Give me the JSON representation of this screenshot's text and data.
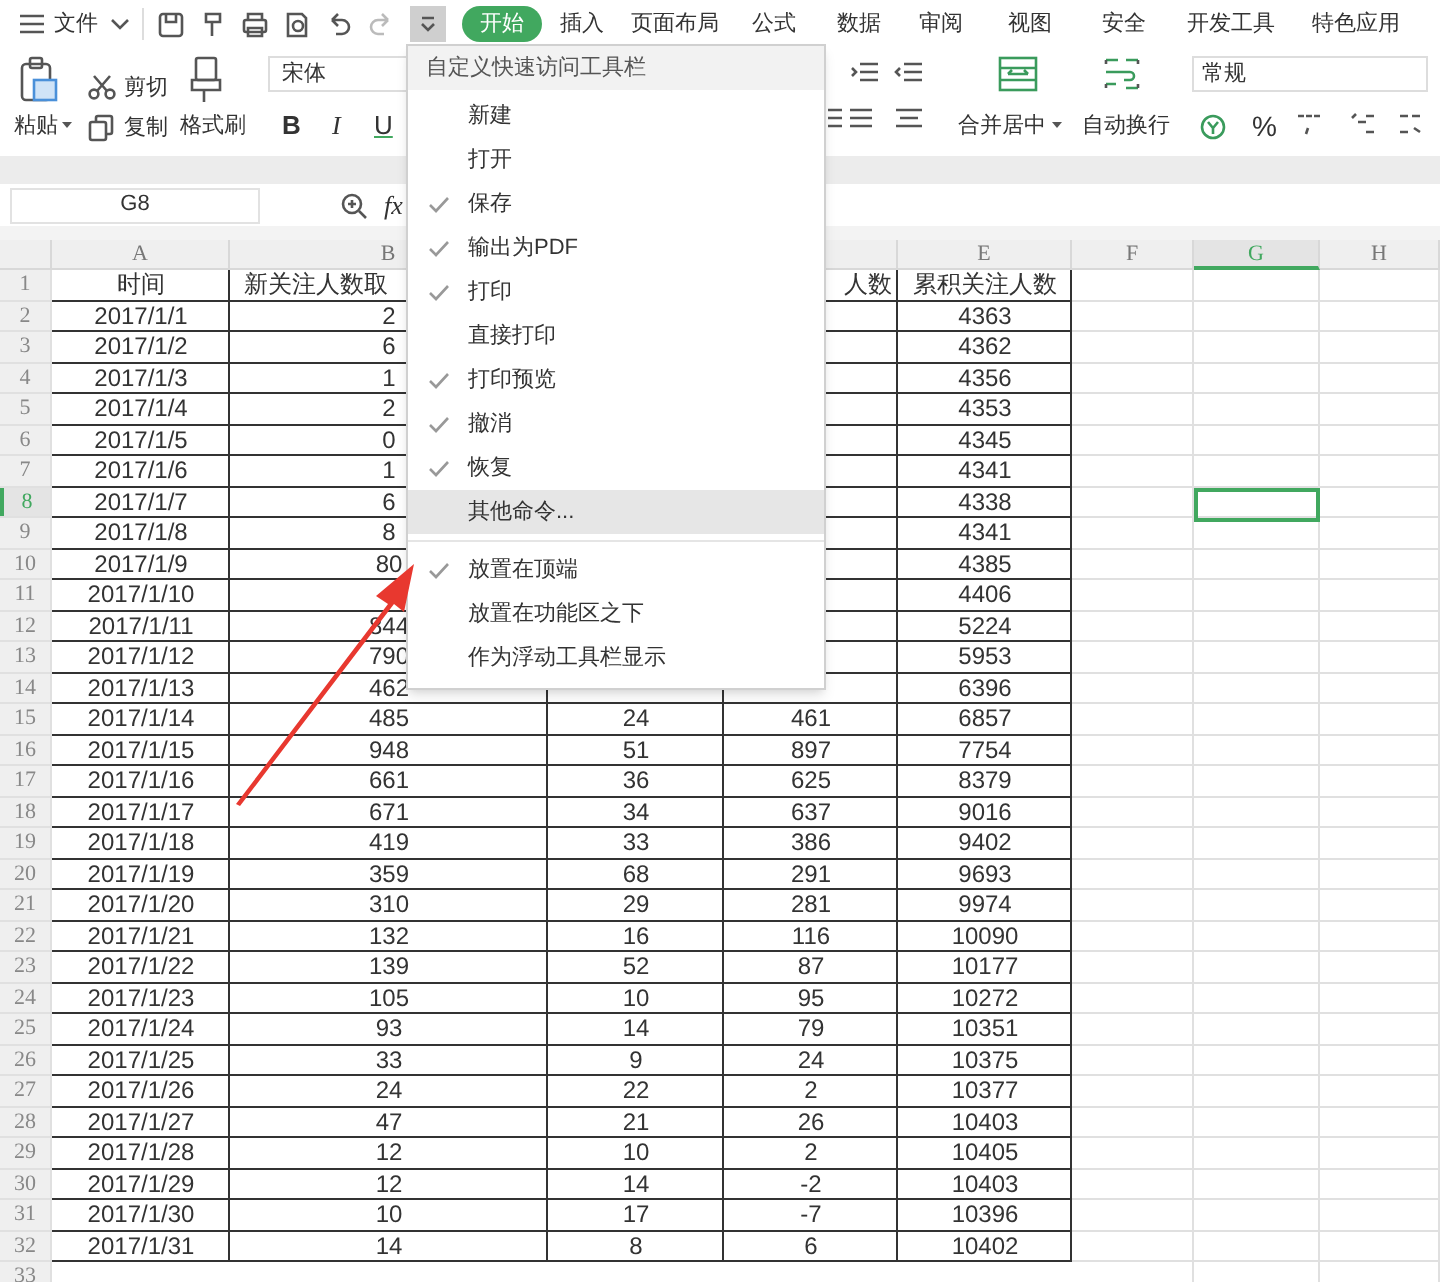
{
  "menubar": {
    "file": "文件",
    "quick_access_dropdown": {
      "expanded": true
    }
  },
  "tabs": [
    {
      "label": "开始",
      "selected": true
    },
    {
      "label": "插入",
      "selected": false
    },
    {
      "label": "页面布局",
      "selected": false
    },
    {
      "label": "公式",
      "selected": false
    },
    {
      "label": "数据",
      "selected": false
    },
    {
      "label": "审阅",
      "selected": false
    },
    {
      "label": "视图",
      "selected": false
    },
    {
      "label": "安全",
      "selected": false
    },
    {
      "label": "开发工具",
      "selected": false
    },
    {
      "label": "特色应用",
      "selected": false
    }
  ],
  "ribbon": {
    "paste": "粘贴",
    "cut": "剪切",
    "copy": "复制",
    "format_painter": "格式刷",
    "font": "宋体",
    "bold": "B",
    "italic": "I",
    "underline": "U",
    "merge": "合并居中",
    "wrap": "自动换行",
    "number_format": "常规",
    "percent": "%"
  },
  "formula_bar": {
    "name_box": "G8",
    "function_label": "fx"
  },
  "dropdown_menu": {
    "title": "自定义快速访问工具栏",
    "items": [
      {
        "kind": "command",
        "label": "新建",
        "checked": false,
        "selected": false
      },
      {
        "kind": "command",
        "label": "打开",
        "checked": false,
        "selected": false
      },
      {
        "kind": "command",
        "label": "保存",
        "checked": true,
        "selected": false
      },
      {
        "kind": "command",
        "label": "输出为PDF",
        "checked": true,
        "selected": false
      },
      {
        "kind": "command",
        "label": "打印",
        "checked": true,
        "selected": false
      },
      {
        "kind": "command",
        "label": "直接打印",
        "checked": false,
        "selected": false
      },
      {
        "kind": "command",
        "label": "打印预览",
        "checked": true,
        "selected": false
      },
      {
        "kind": "command",
        "label": "撤消",
        "checked": true,
        "selected": false
      },
      {
        "kind": "command",
        "label": "恢复",
        "checked": true,
        "selected": false
      },
      {
        "kind": "command",
        "label": "其他命令...",
        "checked": false,
        "selected": true
      },
      {
        "kind": "separator"
      },
      {
        "kind": "command",
        "label": "放置在顶端",
        "checked": true,
        "selected": false
      },
      {
        "kind": "command",
        "label": "放置在功能区之下",
        "checked": false,
        "selected": false
      },
      {
        "kind": "command",
        "label": "作为浮动工具栏显示",
        "checked": false,
        "selected": false
      }
    ]
  },
  "sheet": {
    "columns": [
      {
        "label": "A",
        "selected": false
      },
      {
        "label": "B",
        "selected": false
      },
      {},
      {
        "selected": false
      },
      {
        "label": "E",
        "selected": false
      },
      {
        "label": "F",
        "selected": false
      },
      {
        "label": "G",
        "selected": true
      },
      {
        "label": "H",
        "selected": false
      }
    ],
    "rows": [
      {
        "header": "1",
        "selected": false,
        "cells": {
          "a": "时间",
          "b": "新关注人数取",
          "d": "人数",
          "e": "累积关注人数"
        }
      },
      {
        "header": "2",
        "selected": false,
        "cells": {
          "a": "2017/1/1",
          "b": "2",
          "e": "4363"
        }
      },
      {
        "header": "3",
        "selected": false,
        "cells": {
          "a": "2017/1/2",
          "b": "6",
          "e": "4362"
        }
      },
      {
        "header": "4",
        "selected": false,
        "cells": {
          "a": "2017/1/3",
          "b": "1",
          "e": "4356"
        }
      },
      {
        "header": "5",
        "selected": false,
        "cells": {
          "a": "2017/1/4",
          "b": "2",
          "e": "4353"
        }
      },
      {
        "header": "6",
        "selected": false,
        "cells": {
          "a": "2017/1/5",
          "b": "0",
          "e": "4345"
        }
      },
      {
        "header": "7",
        "selected": false,
        "cells": {
          "a": "2017/1/6",
          "b": "1",
          "e": "4341"
        }
      },
      {
        "header": "8",
        "selected": true,
        "cells": {
          "a": "2017/1/7",
          "b": "6",
          "e": "4338"
        }
      },
      {
        "header": "9",
        "selected": false,
        "cells": {
          "a": "2017/1/8",
          "b": "8",
          "e": "4341"
        }
      },
      {
        "header": "10",
        "selected": false,
        "cells": {
          "a": "2017/1/9",
          "b": "80",
          "e": "4385"
        }
      },
      {
        "header": "11",
        "selected": false,
        "cells": {
          "a": "2017/1/10",
          "e": "4406"
        }
      },
      {
        "header": "12",
        "selected": false,
        "cells": {
          "a": "2017/1/11",
          "b": "844",
          "e": "5224"
        }
      },
      {
        "header": "13",
        "selected": false,
        "cells": {
          "a": "2017/1/12",
          "b": "790",
          "e": "5953"
        }
      },
      {
        "header": "14",
        "selected": false,
        "cells": {
          "a": "2017/1/13",
          "b": "462",
          "e": "6396"
        }
      },
      {
        "header": "15",
        "selected": false,
        "cells": {
          "a": "2017/1/14",
          "b": "485",
          "c": "24",
          "d": "461",
          "e": "6857"
        }
      },
      {
        "header": "16",
        "selected": false,
        "cells": {
          "a": "2017/1/15",
          "b": "948",
          "c": "51",
          "d": "897",
          "e": "7754"
        }
      },
      {
        "header": "17",
        "selected": false,
        "cells": {
          "a": "2017/1/16",
          "b": "661",
          "c": "36",
          "d": "625",
          "e": "8379"
        }
      },
      {
        "header": "18",
        "selected": false,
        "cells": {
          "a": "2017/1/17",
          "b": "671",
          "c": "34",
          "d": "637",
          "e": "9016"
        }
      },
      {
        "header": "19",
        "selected": false,
        "cells": {
          "a": "2017/1/18",
          "b": "419",
          "c": "33",
          "d": "386",
          "e": "9402"
        }
      },
      {
        "header": "20",
        "selected": false,
        "cells": {
          "a": "2017/1/19",
          "b": "359",
          "c": "68",
          "d": "291",
          "e": "9693"
        }
      },
      {
        "header": "21",
        "selected": false,
        "cells": {
          "a": "2017/1/20",
          "b": "310",
          "c": "29",
          "d": "281",
          "e": "9974"
        }
      },
      {
        "header": "22",
        "selected": false,
        "cells": {
          "a": "2017/1/21",
          "b": "132",
          "c": "16",
          "d": "116",
          "e": "10090"
        }
      },
      {
        "header": "23",
        "selected": false,
        "cells": {
          "a": "2017/1/22",
          "b": "139",
          "c": "52",
          "d": "87",
          "e": "10177"
        }
      },
      {
        "header": "24",
        "selected": false,
        "cells": {
          "a": "2017/1/23",
          "b": "105",
          "c": "10",
          "d": "95",
          "e": "10272"
        }
      },
      {
        "header": "25",
        "selected": false,
        "cells": {
          "a": "2017/1/24",
          "b": "93",
          "c": "14",
          "d": "79",
          "e": "10351"
        }
      },
      {
        "header": "26",
        "selected": false,
        "cells": {
          "a": "2017/1/25",
          "b": "33",
          "c": "9",
          "d": "24",
          "e": "10375"
        }
      },
      {
        "header": "27",
        "selected": false,
        "cells": {
          "a": "2017/1/26",
          "b": "24",
          "c": "22",
          "d": "2",
          "e": "10377"
        }
      },
      {
        "header": "28",
        "selected": false,
        "cells": {
          "a": "2017/1/27",
          "b": "47",
          "c": "21",
          "d": "26",
          "e": "10403"
        }
      },
      {
        "header": "29",
        "selected": false,
        "cells": {
          "a": "2017/1/28",
          "b": "12",
          "c": "10",
          "d": "2",
          "e": "10405"
        }
      },
      {
        "header": "30",
        "selected": false,
        "cells": {
          "a": "2017/1/29",
          "b": "12",
          "c": "14",
          "d": "-2",
          "e": "10403"
        }
      },
      {
        "header": "31",
        "selected": false,
        "cells": {
          "a": "2017/1/30",
          "b": "10",
          "c": "17",
          "d": "-7",
          "e": "10396"
        }
      },
      {
        "header": "32",
        "selected": false,
        "cells": {
          "a": "2017/1/31",
          "b": "14",
          "c": "8",
          "d": "6",
          "e": "10402"
        }
      },
      {
        "header": "33",
        "selected": false,
        "cells": {}
      }
    ]
  }
}
